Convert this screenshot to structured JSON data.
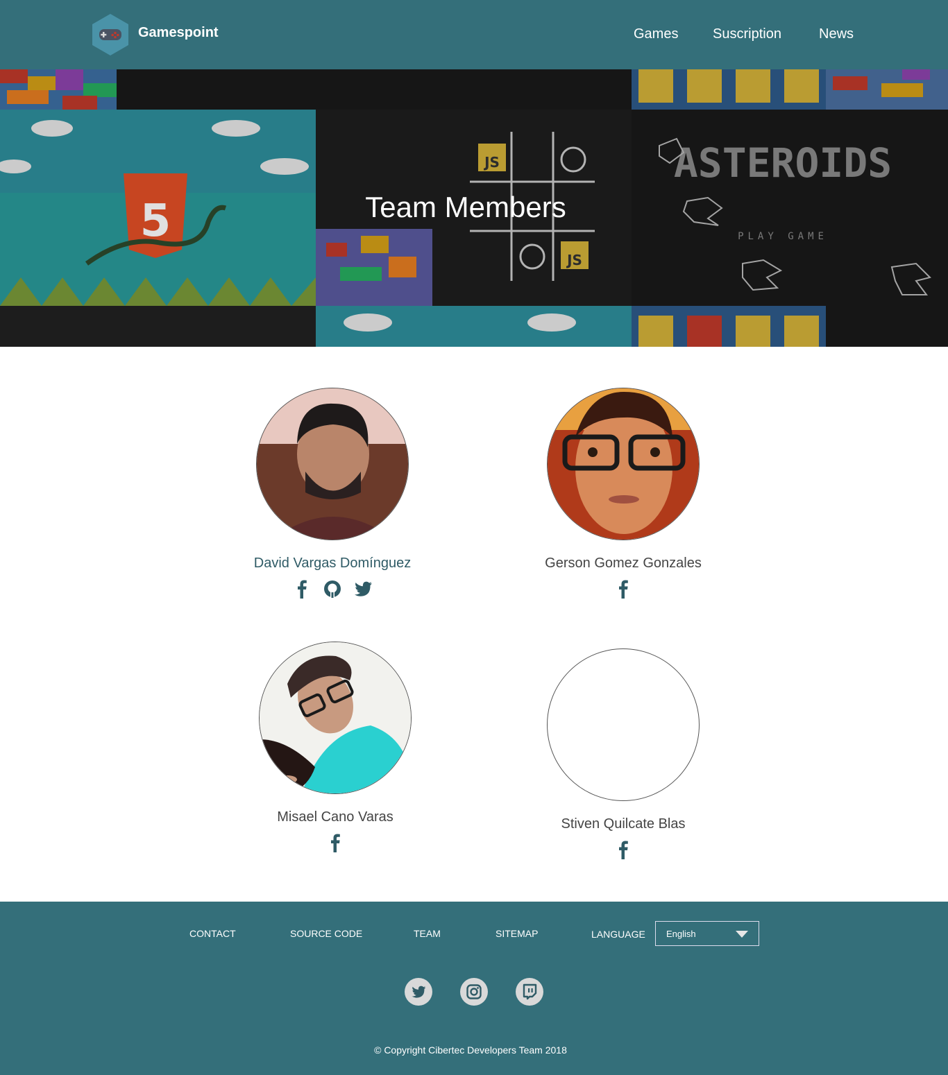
{
  "header": {
    "brand": "Gamespoint",
    "logo_icon": "gamepad-icon",
    "nav": [
      {
        "label": "Games"
      },
      {
        "label": "Suscription"
      },
      {
        "label": "News"
      }
    ]
  },
  "hero": {
    "title": "Team Members",
    "banner_text": "ASTEROIDS",
    "play_text": "PLAY GAME",
    "js_badge": "JS",
    "html_badge": "5"
  },
  "team": [
    {
      "name": "David Vargas Domínguez",
      "socials": [
        "facebook-icon",
        "github-icon",
        "twitter-icon"
      ]
    },
    {
      "name": "Gerson Gomez Gonzales",
      "socials": [
        "facebook-icon"
      ]
    },
    {
      "name": "Misael Cano Varas",
      "socials": [
        "facebook-icon"
      ]
    },
    {
      "name": "Stiven Quilcate Blas",
      "socials": [
        "facebook-icon"
      ]
    }
  ],
  "footer": {
    "links": [
      {
        "label": "CONTACT"
      },
      {
        "label": "SOURCE CODE"
      },
      {
        "label": "TEAM"
      },
      {
        "label": "SITEMAP"
      }
    ],
    "language_label": "LANGUAGE",
    "language_value": "English",
    "social_icons": [
      "twitter-icon",
      "instagram-icon",
      "twitch-icon"
    ],
    "copyright": "© Copyright Cibertec Developers Team 2018"
  },
  "colors": {
    "primary": "#346f7a",
    "icon": "#2f5b66",
    "hero_dark": "#1c1c1c"
  }
}
